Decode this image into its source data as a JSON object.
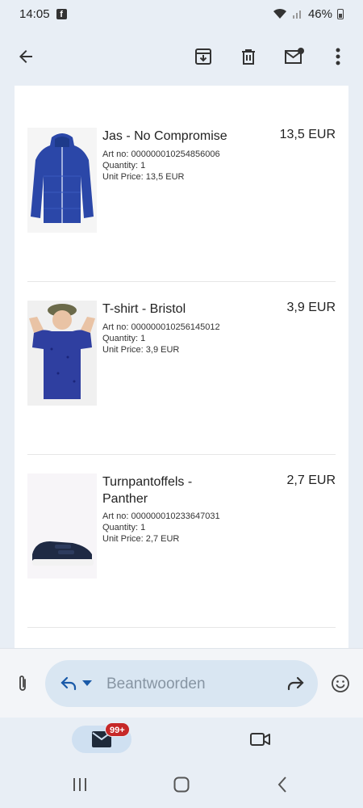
{
  "status_bar": {
    "time": "14:05",
    "notification_icon": "facebook-icon",
    "battery": "46%"
  },
  "app_bar": {
    "back_icon": "arrow-back-icon",
    "actions": [
      "archive-icon",
      "delete-icon",
      "mark-unread-icon",
      "more-vert-icon"
    ]
  },
  "items": [
    {
      "name": "Jas - No Compromise",
      "price": "13,5 EUR",
      "art_no": "Art no: 000000010254856006",
      "quantity": "Quantity: 1",
      "unit_price": "Unit Price: 13,5 EUR"
    },
    {
      "name": "T-shirt - Bristol",
      "price": "3,9 EUR",
      "art_no": "Art no: 000000010256145012",
      "quantity": "Quantity: 1",
      "unit_price": "Unit Price: 3,9 EUR"
    },
    {
      "name": "Turnpantoffels - Panther",
      "price": "2,7 EUR",
      "art_no": "Art no: 000000010233647031",
      "quantity": "Quantity: 1",
      "unit_price": "Unit Price: 2,7 EUR"
    }
  ],
  "reply_bar": {
    "placeholder": "Beantwoorden"
  },
  "bottom_nav": {
    "mail_badge": "99+"
  }
}
